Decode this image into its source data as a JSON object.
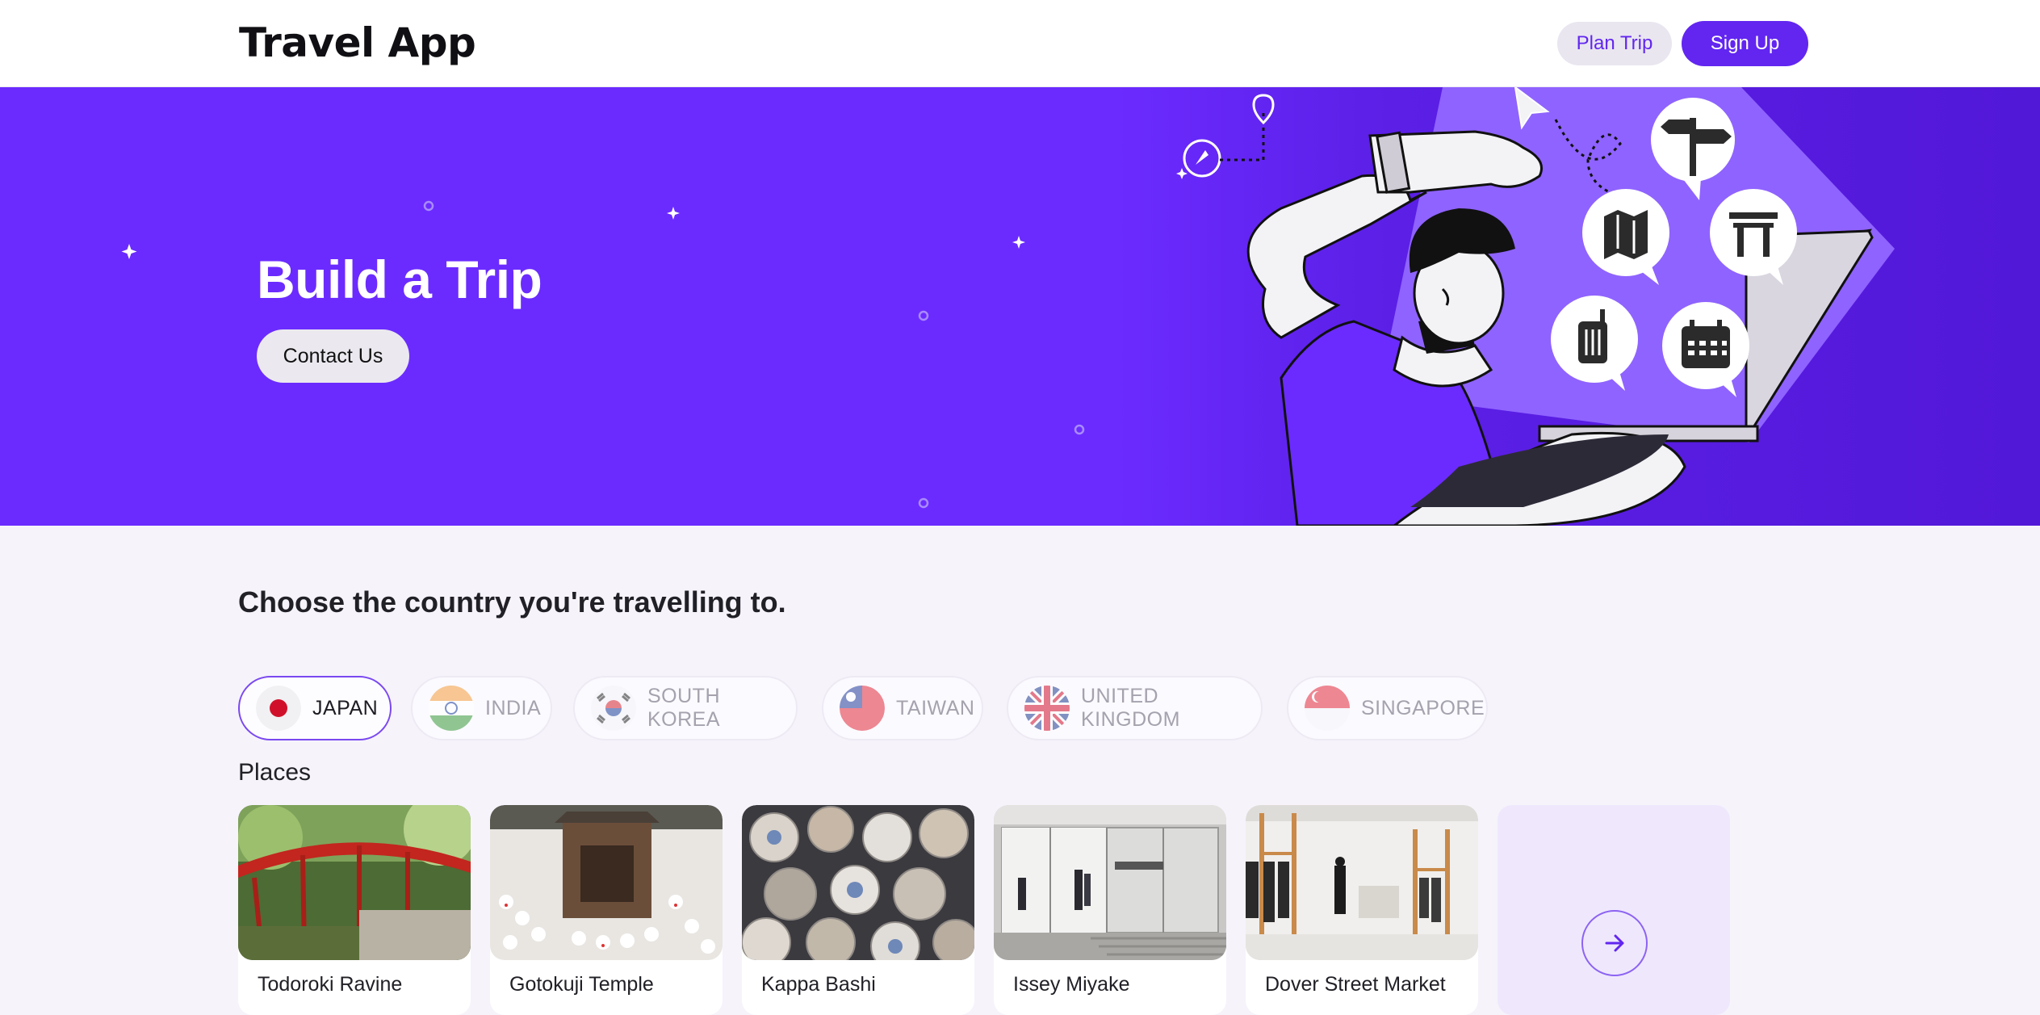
{
  "header": {
    "brand": "Travel App",
    "plan_trip_label": "Plan Trip",
    "sign_up_label": "Sign Up"
  },
  "hero": {
    "title": "Build a Trip",
    "contact_label": "Contact Us"
  },
  "countries": {
    "heading": "Choose the country you're travelling to.",
    "items": [
      {
        "label": "JAPAN",
        "selected": true,
        "flag": "japan-flag"
      },
      {
        "label": "INDIA",
        "selected": false,
        "flag": "india-flag"
      },
      {
        "label": "SOUTH KOREA",
        "selected": false,
        "flag": "south-korea-flag"
      },
      {
        "label": "TAIWAN",
        "selected": false,
        "flag": "taiwan-flag"
      },
      {
        "label": "UNITED KINGDOM",
        "selected": false,
        "flag": "uk-flag"
      },
      {
        "label": "SINGAPORE",
        "selected": false,
        "flag": "singapore-flag"
      }
    ]
  },
  "places": {
    "heading": "Places",
    "cards": [
      {
        "caption": "Todoroki Ravine",
        "photo": "red-bridge-photo"
      },
      {
        "caption": "Gotokuji Temple",
        "photo": "temple-cats-photo"
      },
      {
        "caption": "Kappa Bashi",
        "photo": "ceramic-plates-photo"
      },
      {
        "caption": "Issey Miyake",
        "photo": "store-entrance-photo"
      },
      {
        "caption": "Dover Street Market",
        "photo": "clothing-store-photo"
      }
    ],
    "more_icon": "arrow-right-icon"
  },
  "colors": {
    "accent": "#6226f0",
    "hero_bg": "#6b2bff",
    "page_bg": "#f6f3fb"
  }
}
